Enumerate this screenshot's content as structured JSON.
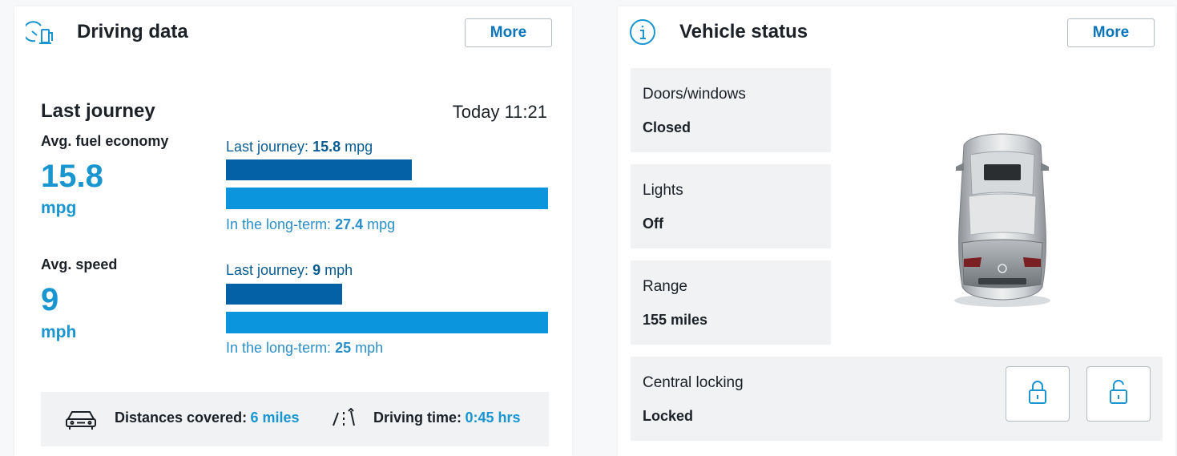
{
  "driving": {
    "title": "Driving data",
    "more_label": "More",
    "last_journey_title": "Last journey",
    "timestamp": "Today 11:21",
    "fuel": {
      "label": "Avg. fuel economy",
      "value": "15.8",
      "unit": "mpg",
      "last_label": "Last journey:",
      "last_value": "15.8",
      "last_unit": "mpg",
      "long_label": "In the long-term:",
      "long_value": "27.4",
      "long_unit": "mpg",
      "last_num": 15.8,
      "long_num": 27.4
    },
    "speed": {
      "label": "Avg. speed",
      "value": "9",
      "unit": "mph",
      "last_label": "Last journey:",
      "last_value": "9",
      "last_unit": "mph",
      "long_label": "In the long-term:",
      "long_value": "25",
      "long_unit": "mph",
      "last_num": 9,
      "long_num": 25
    },
    "footer": {
      "distance_label": "Distances covered:",
      "distance_value": "6 miles",
      "time_label": "Driving time:",
      "time_value": "0:45 hrs"
    },
    "icons": {
      "header": "fuel-gauge-icon",
      "distance": "car-icon",
      "time": "road-icon"
    }
  },
  "status": {
    "title": "Vehicle status",
    "more_label": "More",
    "tiles": [
      {
        "label": "Doors/windows",
        "value": "Closed"
      },
      {
        "label": "Lights",
        "value": "Off"
      },
      {
        "label": "Range",
        "value": "155 miles"
      }
    ],
    "locking": {
      "label": "Central locking",
      "value": "Locked"
    },
    "icons": {
      "header": "info-icon",
      "lock": "lock-closed-icon",
      "unlock": "lock-open-icon",
      "vehicle": "car-top-view-image"
    }
  },
  "colors": {
    "accent": "#1995d0",
    "bar_dark": "#0561a6",
    "bar_light": "#0a95dc",
    "tile_bg": "#f0f2f4"
  }
}
